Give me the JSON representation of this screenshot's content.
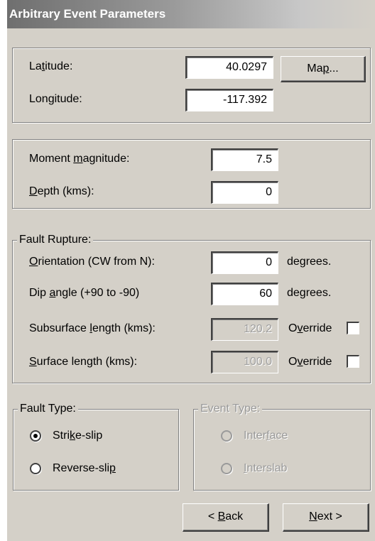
{
  "window": {
    "title": "Arbitrary Event Parameters"
  },
  "location": {
    "latitude_label_pre": "La",
    "latitude_label_key": "t",
    "latitude_label_post": "itude:",
    "latitude_value": "40.0297",
    "longitude_label_pre": "Lon",
    "longitude_label_key": "g",
    "longitude_label_post": "itude:",
    "longitude_value": "-117.392",
    "map_button_pre": "Ma",
    "map_button_key": "p",
    "map_button_post": "..."
  },
  "magnitude": {
    "moment_label_pre": "Moment ",
    "moment_label_key": "m",
    "moment_label_post": "agnitude:",
    "moment_value": "7.5",
    "depth_label_key": "D",
    "depth_label_post": "epth (kms):",
    "depth_value": "0"
  },
  "fault_rupture": {
    "legend": "Fault Rupture:",
    "orientation_label_key": "O",
    "orientation_label_post": "rientation (CW from N):",
    "orientation_value": "0",
    "orientation_unit": "degrees.",
    "dip_label_pre": "Dip ",
    "dip_label_key": "a",
    "dip_label_post": "ngle (+90 to -90)",
    "dip_value": "60",
    "dip_unit": "degrees.",
    "subsurface_label_pre": "Subsurface ",
    "subsurface_label_key": "l",
    "subsurface_label_post": "ength (kms):",
    "subsurface_value": "120.2",
    "override1_pre": "O",
    "override1_key": "v",
    "override1_post": "erride",
    "surface_label_key": "S",
    "surface_label_post": "urface length (kms):",
    "surface_value": "100.0",
    "override2_pre": "O",
    "override2_key": "v",
    "override2_post": "erride"
  },
  "fault_type": {
    "legend": "Fault Type:",
    "strike_pre": "Stri",
    "strike_key": "k",
    "strike_post": "e-slip",
    "reverse_pre": "Reverse-sli",
    "reverse_key": "p",
    "reverse_post": "",
    "selected": "Strike-slip"
  },
  "event_type": {
    "legend": "Event Type:",
    "interface_pre": "Inter",
    "interface_key": "f",
    "interface_post": "ace",
    "interslab_key": "I",
    "interslab_post": "nterslab"
  },
  "nav": {
    "back_pre": "< ",
    "back_key": "B",
    "back_post": "ack",
    "next_key": "N",
    "next_post": "ext >"
  }
}
